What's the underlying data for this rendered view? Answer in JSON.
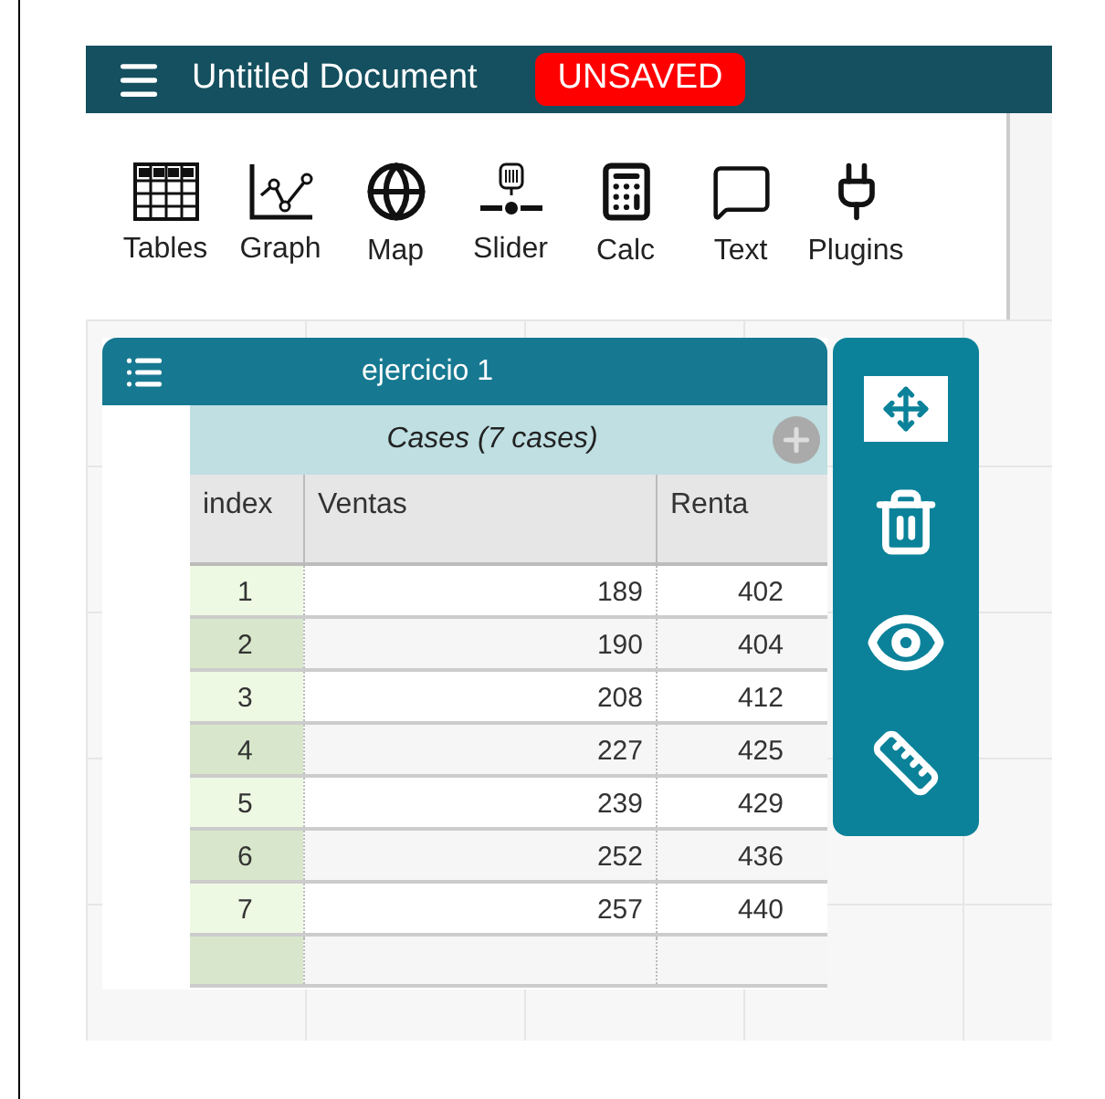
{
  "header": {
    "title": "Untitled Document",
    "badge": "UNSAVED"
  },
  "toolbar": [
    {
      "kind": "tables",
      "label": "Tables"
    },
    {
      "kind": "graph",
      "label": "Graph"
    },
    {
      "kind": "map",
      "label": "Map"
    },
    {
      "kind": "slider",
      "label": "Slider"
    },
    {
      "kind": "calc",
      "label": "Calc"
    },
    {
      "kind": "text",
      "label": "Text"
    },
    {
      "kind": "plugins",
      "label": "Plugins"
    }
  ],
  "table": {
    "title": "ejercicio 1",
    "collection": "Cases (7 cases)",
    "columns": [
      "index",
      "Ventas",
      "Renta"
    ],
    "rows": [
      [
        "1",
        "189",
        "402"
      ],
      [
        "2",
        "190",
        "404"
      ],
      [
        "3",
        "208",
        "412"
      ],
      [
        "4",
        "227",
        "425"
      ],
      [
        "5",
        "239",
        "429"
      ],
      [
        "6",
        "252",
        "436"
      ],
      [
        "7",
        "257",
        "440"
      ]
    ]
  },
  "inspector": [
    {
      "kind": "resize"
    },
    {
      "kind": "trash"
    },
    {
      "kind": "eye"
    },
    {
      "kind": "ruler"
    }
  ]
}
